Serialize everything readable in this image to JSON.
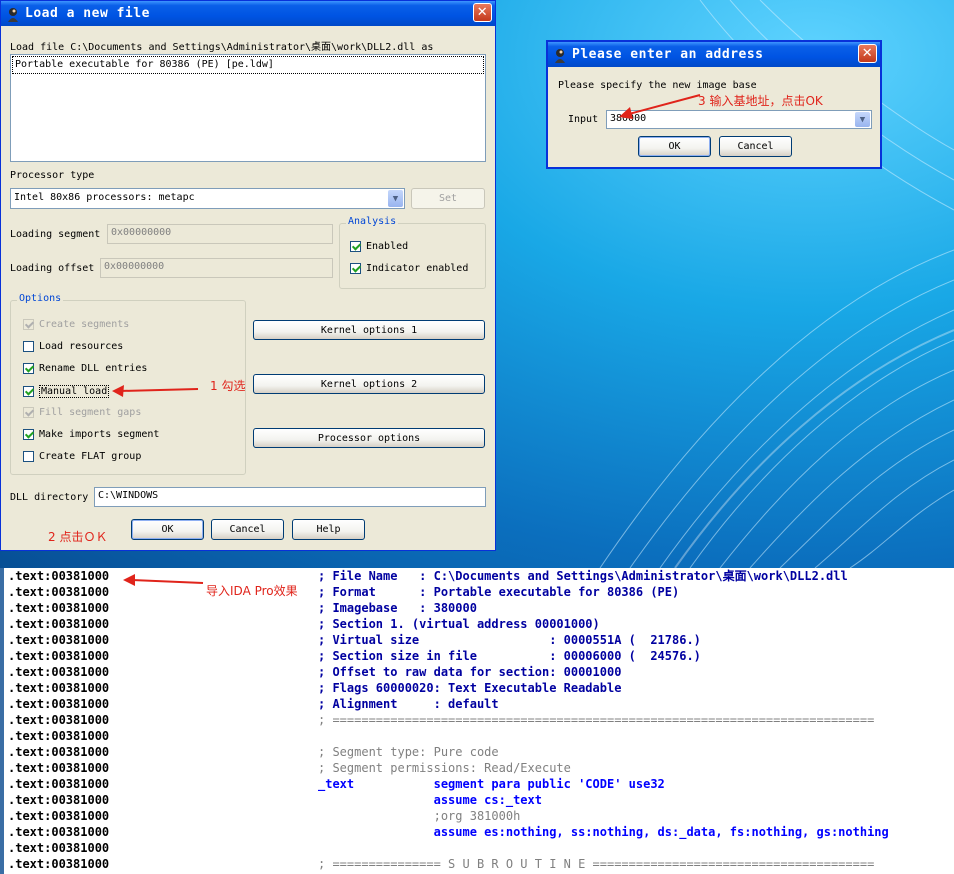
{
  "load_dialog": {
    "title": "Load a new file",
    "load_file_label": "Load file C:\\Documents and Settings\\Administrator\\桌面\\work\\DLL2.dll as",
    "format_list": [
      "Portable executable for 80386 (PE) [pe.ldw]"
    ],
    "processor_type_label": "Processor type",
    "processor_value": "Intel 80x86 processors: metapc",
    "set_button": "Set",
    "loading_segment_label": "Loading segment",
    "loading_segment_value": "0x00000000",
    "loading_offset_label": "Loading offset",
    "loading_offset_value": "0x00000000",
    "analysis": {
      "title": "Analysis",
      "enabled": {
        "label": "Enabled",
        "checked": true
      },
      "indicator": {
        "label": "Indicator enabled",
        "checked": true
      }
    },
    "options": {
      "title": "Options",
      "items": [
        {
          "label": "Create segments",
          "checked": true,
          "disabled": true
        },
        {
          "label": "Load resources",
          "checked": false,
          "disabled": false
        },
        {
          "label": "Rename DLL entries",
          "checked": true,
          "disabled": false
        },
        {
          "label": "Manual load",
          "checked": true,
          "disabled": false
        },
        {
          "label": "Fill segment gaps",
          "checked": true,
          "disabled": true
        },
        {
          "label": "Make imports segment",
          "checked": true,
          "disabled": false
        },
        {
          "label": "Create FLAT group",
          "checked": false,
          "disabled": false
        }
      ]
    },
    "kernel_options_1": "Kernel options 1",
    "kernel_options_2": "Kernel options 2",
    "processor_options": "Processor options",
    "dll_directory_label": "DLL directory",
    "dll_directory_value": "C:\\WINDOWS",
    "ok_button": "OK",
    "cancel_button": "Cancel",
    "help_button": "Help"
  },
  "address_dialog": {
    "title": "Please enter an address",
    "prompt": "Please specify the new image base",
    "input_label": "Input",
    "input_value": "380000",
    "ok_button": "OK",
    "cancel_button": "Cancel"
  },
  "annotations": {
    "step1": "1 勾选",
    "step2": "2 点击ＯＫ",
    "step3": "3 输入基地址，点击OK",
    "ida": "导入IDA Pro效果"
  },
  "ida_listing": {
    "address": ".text:00381000",
    "lines": [
      {
        "text": "; File Name   : C:\\Documents and Settings\\Administrator\\桌面\\work\\DLL2.dll",
        "style": "blue"
      },
      {
        "text": "; Format      : Portable executable for 80386 (PE)",
        "style": "blue"
      },
      {
        "text": "; Imagebase   : 380000",
        "style": "blue"
      },
      {
        "text": "; Section 1. (virtual address 00001000)",
        "style": "blue"
      },
      {
        "text": "; Virtual size                  : 0000551A (  21786.)",
        "style": "blue"
      },
      {
        "text": "; Section size in file          : 00006000 (  24576.)",
        "style": "blue"
      },
      {
        "text": "; Offset to raw data for section: 00001000",
        "style": "blue"
      },
      {
        "text": "; Flags 60000020: Text Executable Readable",
        "style": "blue"
      },
      {
        "text": "; Alignment     : default",
        "style": "blue"
      },
      {
        "text": "; ===========================================================================",
        "style": "gray"
      },
      {
        "text": "",
        "style": "blue"
      },
      {
        "text": "; Segment type: Pure code",
        "style": "gray"
      },
      {
        "text": "; Segment permissions: Read/Execute",
        "style": "gray"
      },
      {
        "text": "_text           segment para public 'CODE' use32",
        "style": "kw"
      },
      {
        "text": "                assume cs:_text",
        "style": "kw"
      },
      {
        "text": "                ;org 381000h",
        "style": "gray"
      },
      {
        "text": "                assume es:nothing, ss:nothing, ds:_data, fs:nothing, gs:nothing",
        "style": "kw"
      },
      {
        "text": "",
        "style": "blue"
      },
      {
        "text": "; =============== S U B R O U T I N E =======================================",
        "style": "gray"
      }
    ]
  },
  "colors": {
    "titlebar": "#0054e3",
    "dialog_bg": "#ece9d8",
    "annotation_red": "#e0241b",
    "ida_comment_blue": "#0000a0"
  }
}
